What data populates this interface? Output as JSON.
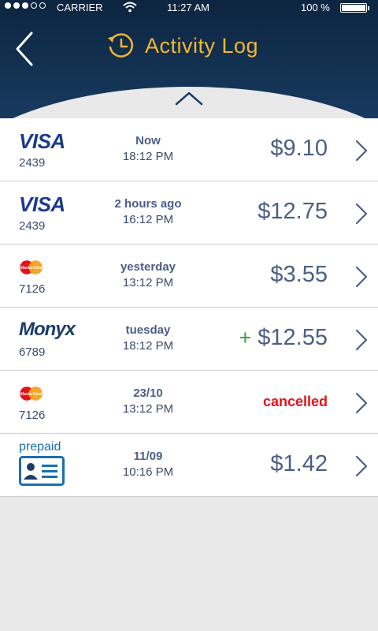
{
  "status_bar": {
    "carrier": "CARRIER",
    "time": "11:27 AM",
    "battery": "100 %"
  },
  "header": {
    "title": "Activity Log",
    "accent_color": "#f2b631",
    "background_color": "#173a5f"
  },
  "transactions": [
    {
      "logo": "visa",
      "logo_text": "VISA",
      "card": "2439",
      "when": "Now",
      "time": "18:12 PM",
      "amount": "$9.10",
      "status": ""
    },
    {
      "logo": "visa",
      "logo_text": "VISA",
      "card": "2439",
      "when": "2 hours ago",
      "time": "16:12 PM",
      "amount": "$12.75",
      "status": ""
    },
    {
      "logo": "mastercard",
      "logo_text": "MasterCard",
      "card": "7126",
      "when": "yesterday",
      "time": "13:12 PM",
      "amount": "$3.55",
      "status": ""
    },
    {
      "logo": "monyx",
      "logo_text": "Monyx",
      "card": "6789",
      "when": "tuesday",
      "time": "18:12 PM",
      "amount": "$12.55",
      "sign": "+",
      "status": ""
    },
    {
      "logo": "mastercard",
      "logo_text": "MasterCard",
      "card": "7126",
      "when": "23/10",
      "time": "13:12 PM",
      "amount": "",
      "status": "cancelled"
    },
    {
      "logo": "prepaid",
      "logo_text": "prepaid",
      "card": "",
      "when": "11/09",
      "time": "10:16 PM",
      "amount": "$1.42",
      "status": ""
    }
  ],
  "colors": {
    "amount": "#4b5e86",
    "positive": "#2ea93a",
    "cancelled": "#e3131b"
  },
  "icons": {
    "back": "chevron-left-icon",
    "history": "clock-history-icon",
    "collapse": "chevron-up-icon",
    "row": "chevron-right-icon"
  }
}
